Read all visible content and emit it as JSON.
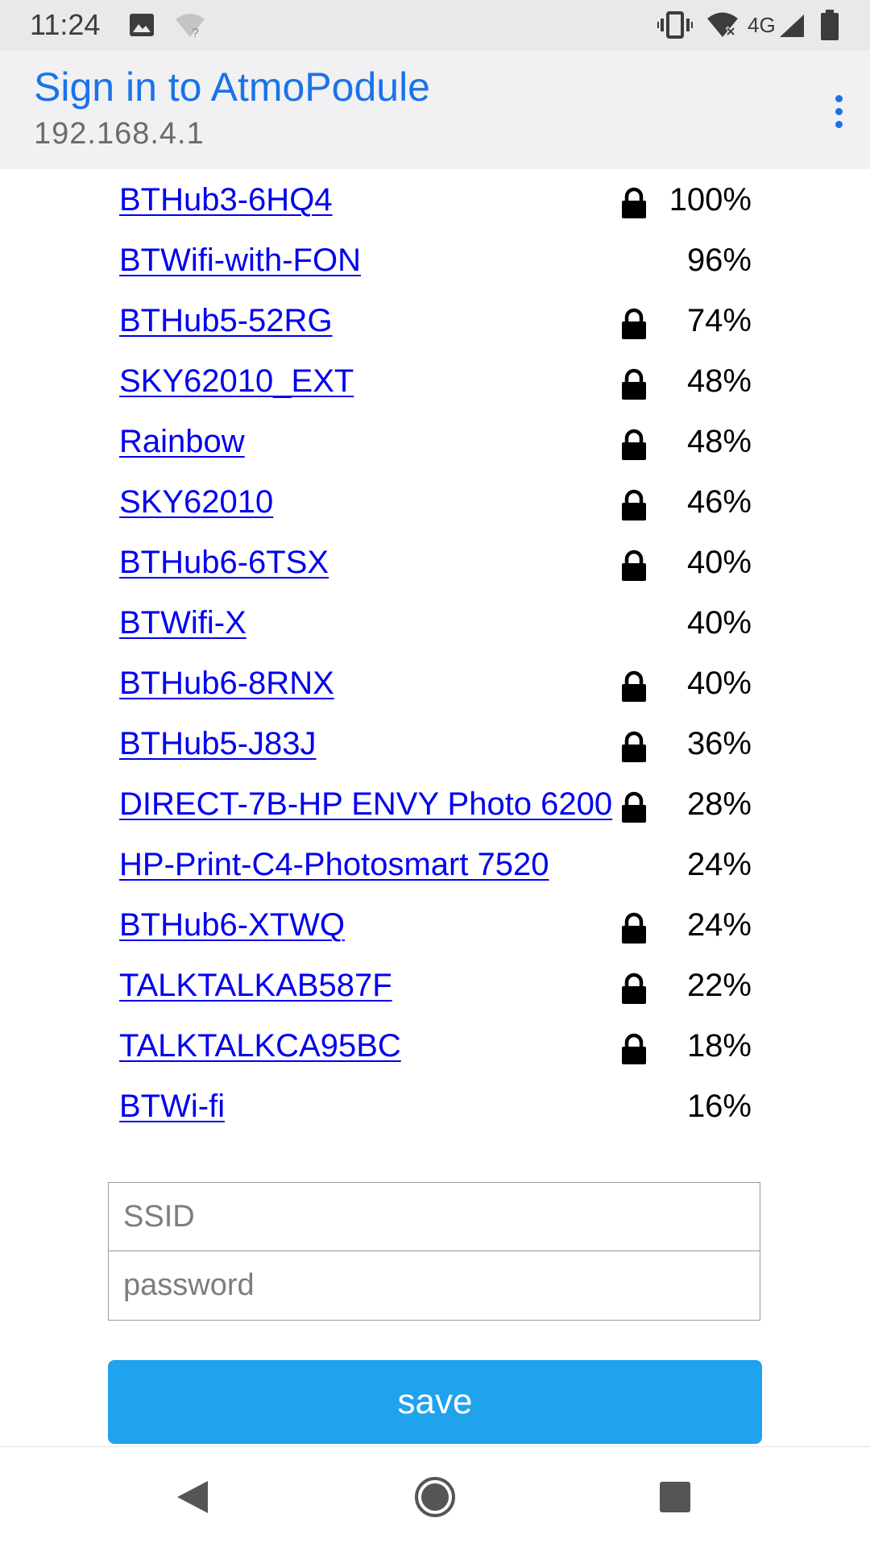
{
  "status_bar": {
    "time": "11:24",
    "network_type": "4G",
    "icons": [
      "image-icon",
      "wifi-unknown-icon",
      "vibrate-icon",
      "wifi-no-internet-icon",
      "cell-signal-icon",
      "battery-icon"
    ]
  },
  "header": {
    "title": "Sign in to AtmoPodule",
    "url": "192.168.4.1",
    "menu_icon": "more-vert-icon"
  },
  "networks": [
    {
      "ssid": "BTHub3-6HQ4",
      "locked": true,
      "signal": "100%"
    },
    {
      "ssid": "BTWifi-with-FON",
      "locked": false,
      "signal": "96%"
    },
    {
      "ssid": "BTHub5-52RG",
      "locked": true,
      "signal": "74%"
    },
    {
      "ssid": "SKY62010_EXT",
      "locked": true,
      "signal": "48%"
    },
    {
      "ssid": "Rainbow",
      "locked": true,
      "signal": "48%"
    },
    {
      "ssid": "SKY62010",
      "locked": true,
      "signal": "46%"
    },
    {
      "ssid": "BTHub6-6TSX",
      "locked": true,
      "signal": "40%"
    },
    {
      "ssid": "BTWifi-X",
      "locked": false,
      "signal": "40%"
    },
    {
      "ssid": "BTHub6-8RNX",
      "locked": true,
      "signal": "40%"
    },
    {
      "ssid": "BTHub5-J83J",
      "locked": true,
      "signal": "36%"
    },
    {
      "ssid": "DIRECT-7B-HP ENVY Photo 6200",
      "locked": true,
      "signal": "28%"
    },
    {
      "ssid": "HP-Print-C4-Photosmart 7520",
      "locked": false,
      "signal": "24%"
    },
    {
      "ssid": "BTHub6-XTWQ",
      "locked": true,
      "signal": "24%"
    },
    {
      "ssid": "TALKTALKAB587F",
      "locked": true,
      "signal": "22%"
    },
    {
      "ssid": "TALKTALKCA95BC",
      "locked": true,
      "signal": "18%"
    },
    {
      "ssid": "BTWi-fi",
      "locked": false,
      "signal": "16%"
    }
  ],
  "form": {
    "ssid_placeholder": "SSID",
    "ssid_value": "",
    "password_placeholder": "password",
    "password_value": "",
    "save_label": "save"
  },
  "nav_bar": {
    "back_icon": "back-triangle-icon",
    "home_icon": "home-circle-icon",
    "recents_icon": "recents-square-icon"
  },
  "colors": {
    "accent": "#1a73e8",
    "link": "#0000ee",
    "button": "#1fa3ec",
    "status_bar": "#e9e9ec",
    "header": "#f1f1f3"
  }
}
